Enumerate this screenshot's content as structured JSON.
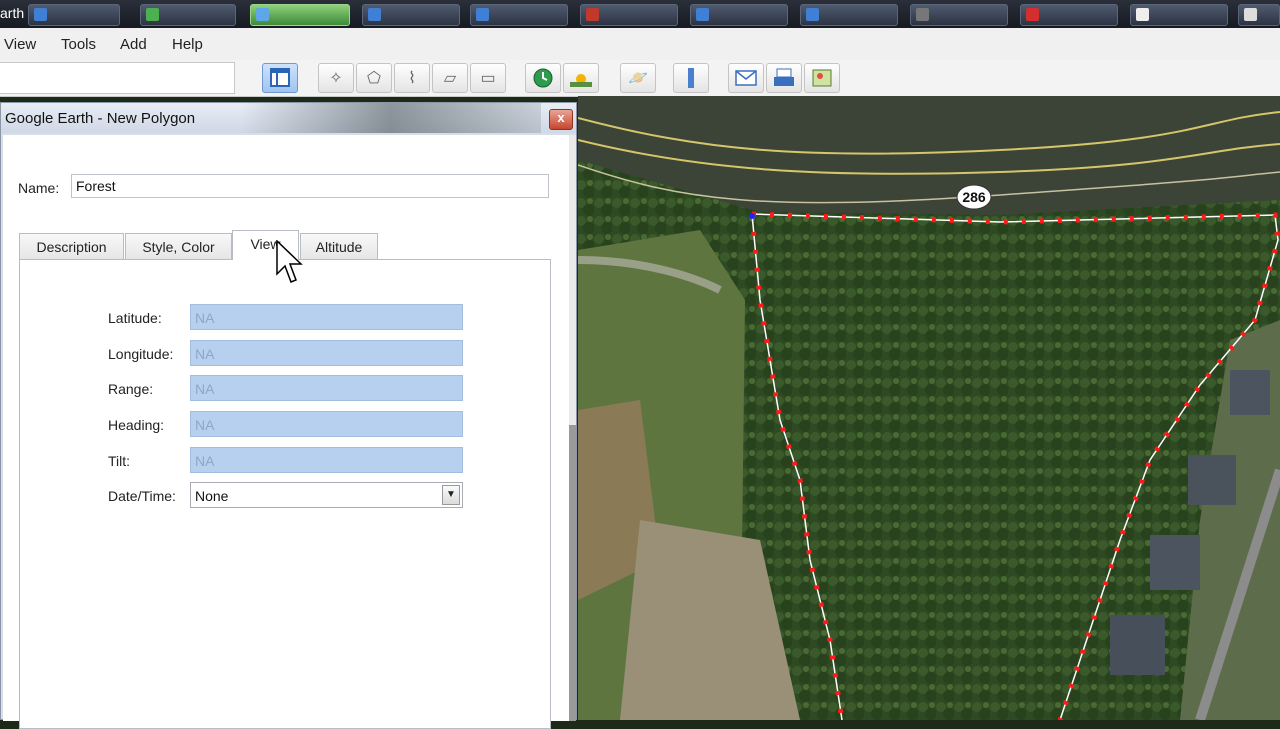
{
  "taskbar": {
    "app_title": "arth"
  },
  "menu": {
    "items": [
      "View",
      "Tools",
      "Add",
      "Help"
    ]
  },
  "toolbar": {
    "tools": [
      "sidebar-toggle-icon",
      "add-placemark-icon",
      "add-polygon-icon",
      "add-path-icon",
      "add-image-overlay-icon",
      "record-tour-icon",
      "historical-imagery-icon",
      "sunlight-icon",
      "planets-icon",
      "ruler-icon",
      "email-icon",
      "print-icon",
      "view-in-maps-icon"
    ]
  },
  "map": {
    "road_label": "286",
    "polygon_color": "#ff1a1a"
  },
  "dialog": {
    "title": "Google Earth - New Polygon",
    "close_label": "x",
    "name_label": "Name:",
    "name_value": "Forest",
    "tabs": [
      "Description",
      "Style, Color",
      "View",
      "Altitude"
    ],
    "selected_tab": "View",
    "fields": {
      "latitude_label": "Latitude:",
      "latitude_value": "NA",
      "longitude_label": "Longitude:",
      "longitude_value": "NA",
      "range_label": "Range:",
      "range_value": "NA",
      "heading_label": "Heading:",
      "heading_value": "NA",
      "tilt_label": "Tilt:",
      "tilt_value": "NA",
      "datetime_label": "Date/Time:",
      "datetime_value": "None"
    }
  }
}
